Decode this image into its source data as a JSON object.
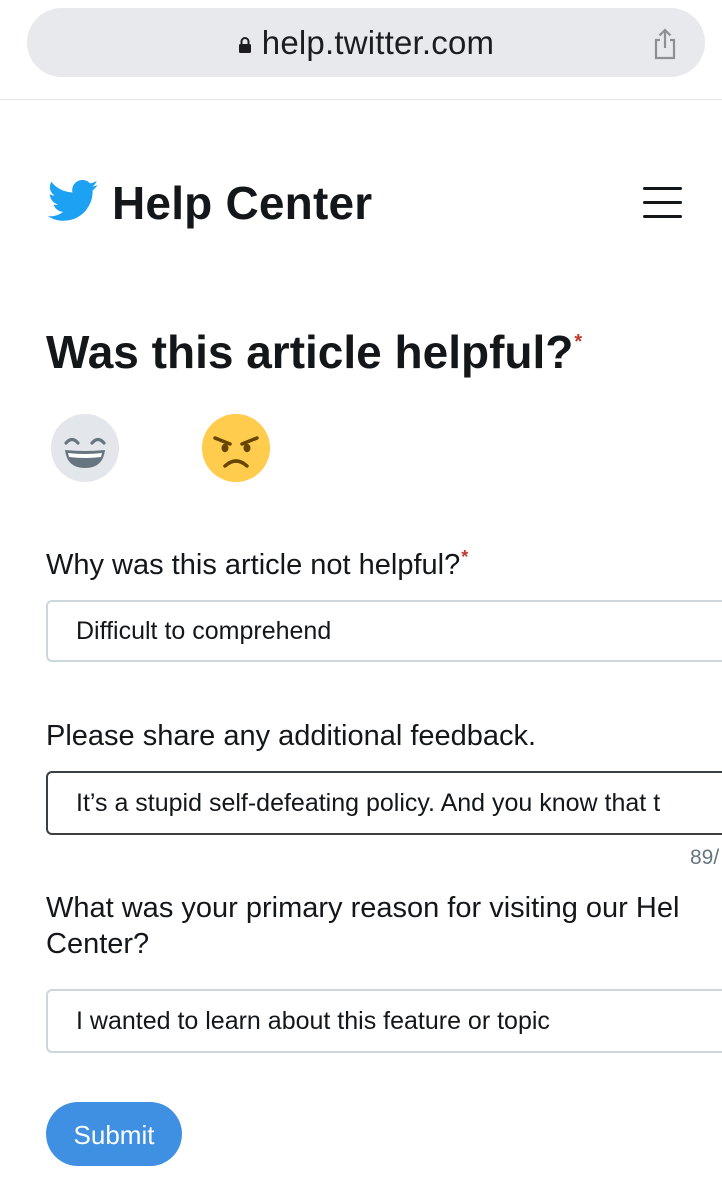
{
  "browser": {
    "url": "help.twitter.com",
    "icons": [
      "lock-icon",
      "share-icon"
    ]
  },
  "header": {
    "title": "Help Center",
    "icons": [
      "twitter-bird-icon",
      "menu-icon"
    ],
    "brand_color": "#1da1f2"
  },
  "helpful": {
    "question": "Was this article helpful?",
    "required_mark": "*",
    "options": [
      {
        "icon": "grinning-face-emoji",
        "state": "unselected",
        "color": "#e3e6ea"
      },
      {
        "icon": "angry-face-emoji",
        "state": "selected",
        "color": "#ffcc4d"
      }
    ]
  },
  "form": {
    "reason_label": "Why was this article not helpful?",
    "reason_required_mark": "*",
    "reason_value": "Difficult to comprehend",
    "feedback_label": "Please share any additional feedback.",
    "feedback_value": "It’s a stupid self-defeating policy. And you know that t",
    "feedback_counter": "89/",
    "visit_label": "What was your primary reason for visiting our Help Center?",
    "visit_label_line1": "What was your primary reason for visiting our Hel",
    "visit_label_line2": "Center?",
    "visit_value": "I wanted to learn about this feature or topic",
    "submit_label": "Submit"
  },
  "colors": {
    "submit": "#3f8fe2",
    "required": "#c0392b",
    "text": "#14171a"
  }
}
